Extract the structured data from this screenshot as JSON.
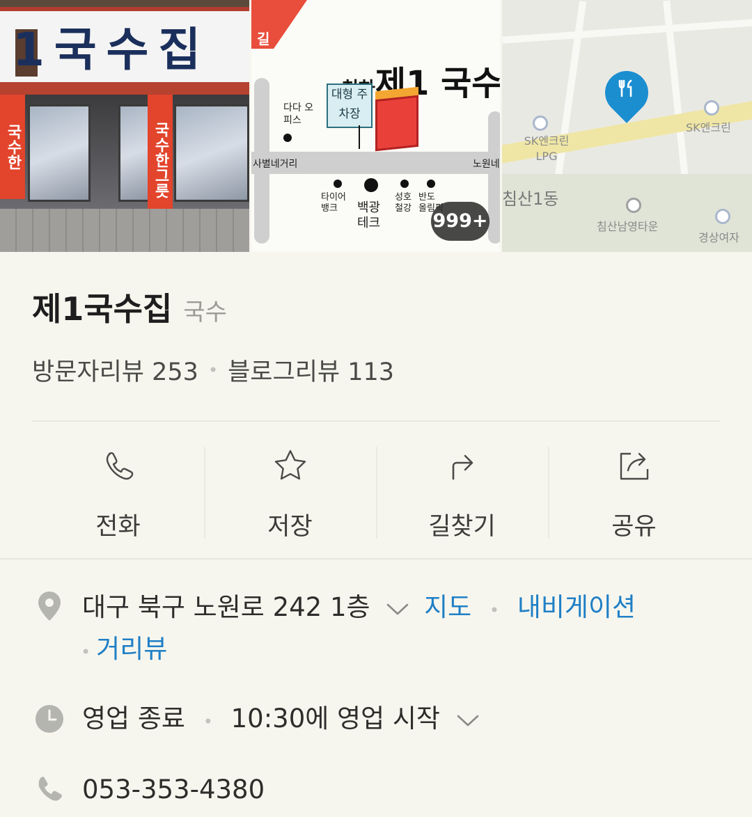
{
  "photos": {
    "store_sign": "1국수집",
    "store_banner": "국수한그릇",
    "store_banner_left": "국수한",
    "flyer_corner": "길",
    "flyer_title_small": "천하",
    "flyer_title": "제1 국수",
    "flyer_parking": "대형 주차장",
    "flyer_labels": [
      "다다 오피스",
      "사별네거리",
      "노원네",
      "타이어 뱅크",
      "백광 테크",
      "성호 철강",
      "반도 올림픽"
    ],
    "photo_count_badge": "999+",
    "map_labels": [
      "SK엔크린 LPG",
      "SK엔크린",
      "침산1동",
      "침산남영타운",
      "경상여자"
    ]
  },
  "place": {
    "name": "제1국수집",
    "category": "국수",
    "visitor_reviews": "방문자리뷰 253",
    "blog_reviews": "블로그리뷰 113"
  },
  "actions": [
    {
      "label": "전화",
      "icon": "phone-icon"
    },
    {
      "label": "저장",
      "icon": "star-icon"
    },
    {
      "label": "길찾기",
      "icon": "directions-icon"
    },
    {
      "label": "공유",
      "icon": "share-icon"
    }
  ],
  "info": {
    "address": "대구 북구 노원로 242 1층",
    "map_link": "지도",
    "navigation_link": "내비게이션",
    "street_view_link": "거리뷰",
    "hours_status": "영업 종료",
    "hours_next": "10:30에 영업 시작",
    "phone": "053-353-4380"
  },
  "colors": {
    "background": "#f7f6ee",
    "link": "#1f7fc6",
    "pin": "#1b8ed0",
    "icon_gray": "#b5b5b0"
  }
}
